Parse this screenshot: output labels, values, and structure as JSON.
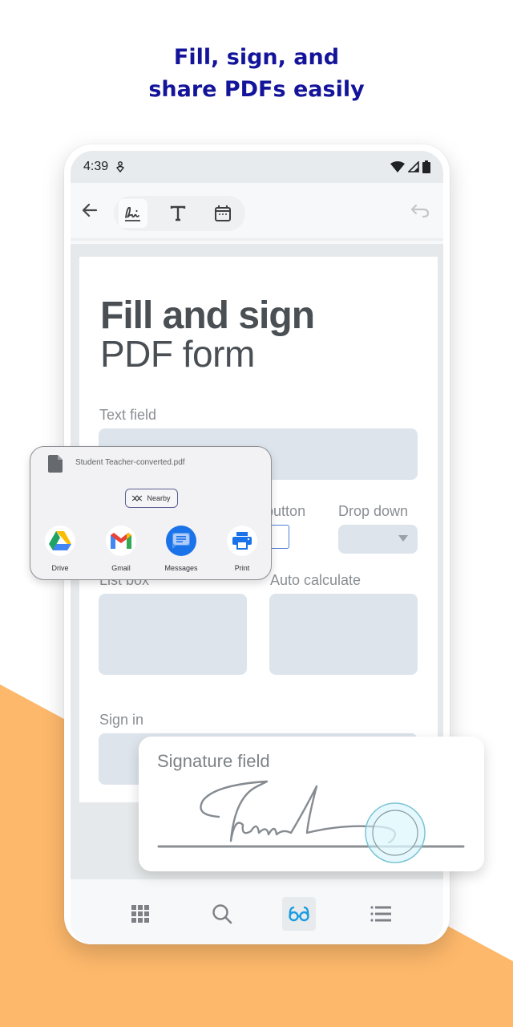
{
  "headline": {
    "line1": "Fill, sign, and",
    "line2": "share PDFs easily"
  },
  "colors": {
    "headline": "#13149a",
    "accent_orange": "#fdb86b",
    "active_icon": "#1a9be0",
    "field_fill": "#dde4ec"
  },
  "status_bar": {
    "time": "4:39",
    "icons": [
      "notification-icon",
      "wifi-icon",
      "signal-icon",
      "battery-icon"
    ]
  },
  "toolbar": {
    "back_icon": "arrow-left-icon",
    "tools": [
      {
        "name": "signature-tool",
        "icon": "signature-icon",
        "active": true
      },
      {
        "name": "text-tool",
        "icon": "text-T-icon",
        "active": false
      },
      {
        "name": "date-tool",
        "icon": "calendar-icon",
        "active": false
      }
    ],
    "undo_icon": "undo-icon"
  },
  "document": {
    "title_bold": "Fill and sign",
    "title_light": "PDF form",
    "fields": {
      "text_field": "Text field",
      "radio_button": "Radio button",
      "drop_down": "Drop down",
      "list_box": "List box",
      "auto_calculate": "Auto calculate",
      "sign_in": "Sign in"
    }
  },
  "share_sheet": {
    "file_name": "Student Teacher-converted.pdf",
    "nearby_label": "Nearby",
    "apps": [
      {
        "label": "Drive",
        "icon": "google-drive-icon"
      },
      {
        "label": "Gmail",
        "icon": "gmail-icon"
      },
      {
        "label": "Messages",
        "icon": "messages-icon"
      },
      {
        "label": "Print",
        "icon": "printer-icon"
      }
    ]
  },
  "signature_card": {
    "label": "Signature field"
  },
  "bottom_nav": {
    "items": [
      {
        "name": "apps",
        "icon": "grid-icon",
        "active": false
      },
      {
        "name": "search",
        "icon": "search-icon",
        "active": false
      },
      {
        "name": "reading-mode",
        "icon": "glasses-icon",
        "active": true
      },
      {
        "name": "outline",
        "icon": "list-icon",
        "active": false
      }
    ]
  }
}
